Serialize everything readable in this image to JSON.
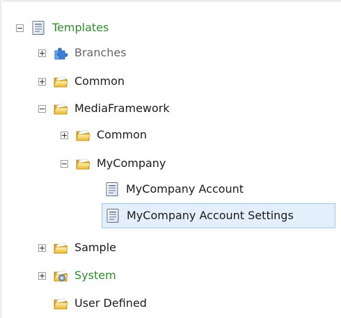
{
  "tree": {
    "templates": {
      "label": "Templates",
      "color": "#2e8b2e"
    },
    "branches": {
      "label": "Branches"
    },
    "common_root": {
      "label": "Common"
    },
    "media_framework": {
      "label": "MediaFramework"
    },
    "media_common": {
      "label": "Common"
    },
    "my_company": {
      "label": "MyCompany"
    },
    "my_company_account": {
      "label": "MyCompany Account"
    },
    "my_company_account_settings": {
      "label": "MyCompany Account Settings",
      "selected": true
    },
    "sample": {
      "label": "Sample"
    },
    "system": {
      "label": "System",
      "color": "#2e8b2e"
    },
    "user_defined": {
      "label": "User Defined"
    }
  },
  "icons": {
    "template": "template-icon",
    "folder": "folder-icon",
    "branches": "puzzle-icon",
    "system": "system-folder-icon"
  },
  "colors": {
    "selection_bg": "#e3f0fb",
    "selection_border": "#9ec8ea",
    "folder": "#f2c94c"
  }
}
